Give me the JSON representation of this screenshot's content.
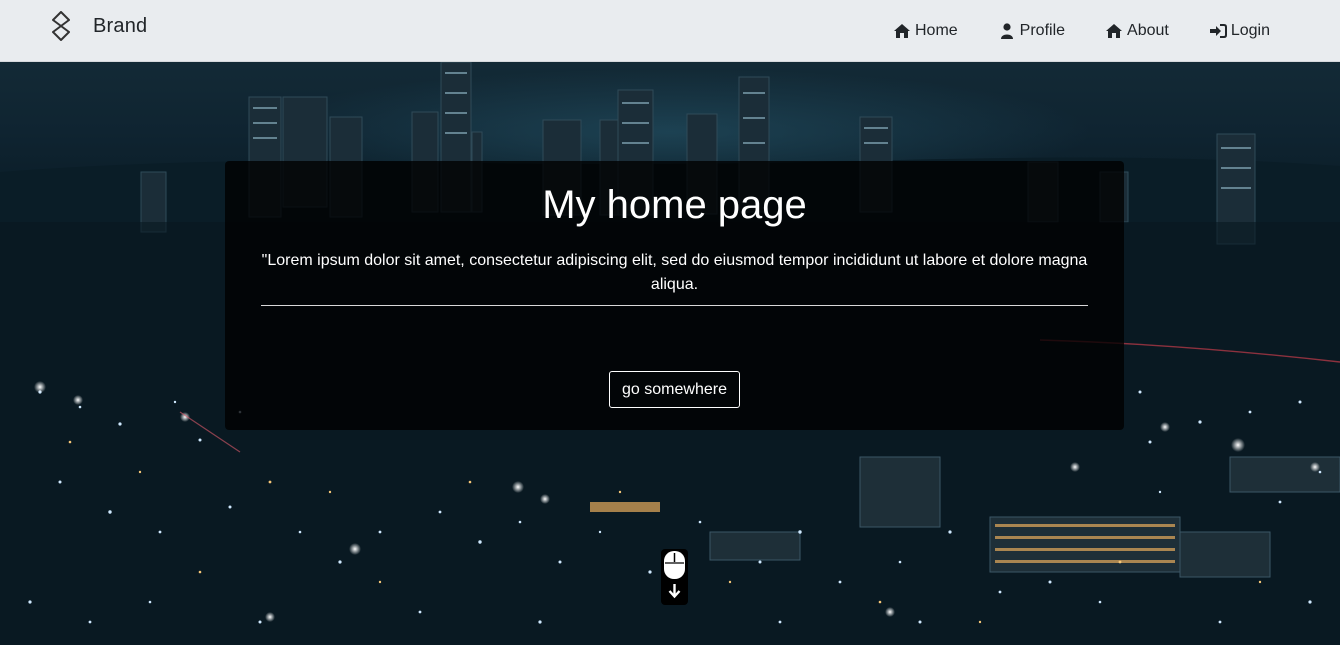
{
  "navbar": {
    "brand": {
      "label": "Brand",
      "icon": "brand-logo-icon"
    },
    "links": [
      {
        "label": "Home",
        "icon": "home-icon"
      },
      {
        "label": "Profile",
        "icon": "user-icon"
      },
      {
        "label": "About",
        "icon": "home-icon"
      },
      {
        "label": "Login",
        "icon": "sign-in-icon"
      }
    ],
    "background_color": "#e9ecef"
  },
  "hero": {
    "background": "night city skyline",
    "card": {
      "title": "My home page",
      "text": "\"Lorem ipsum dolor sit amet, consectetur adipiscing elit, sed do eiusmod tempor incididunt ut labore et dolore magna aliqua.",
      "button_label": "go somewhere"
    },
    "scroll_hint_icon": "mouse-scroll-down-icon"
  }
}
